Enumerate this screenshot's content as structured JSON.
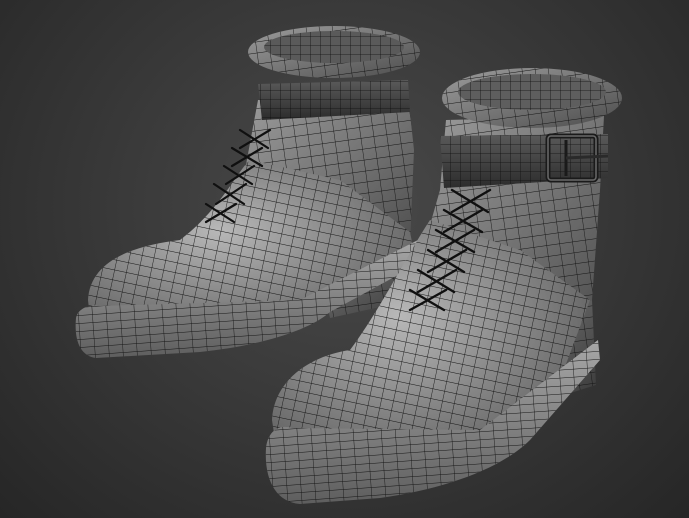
{
  "scene": {
    "objects": [
      {
        "name": "boot-back",
        "type": "boot",
        "view": "wireframe-on-shaded"
      },
      {
        "name": "boot-front",
        "type": "boot",
        "view": "wireframe-on-shaded"
      }
    ],
    "colors": {
      "background": "#3a3a3a",
      "mesh_shading": "#8a8a8a",
      "wire": "#141414"
    }
  }
}
